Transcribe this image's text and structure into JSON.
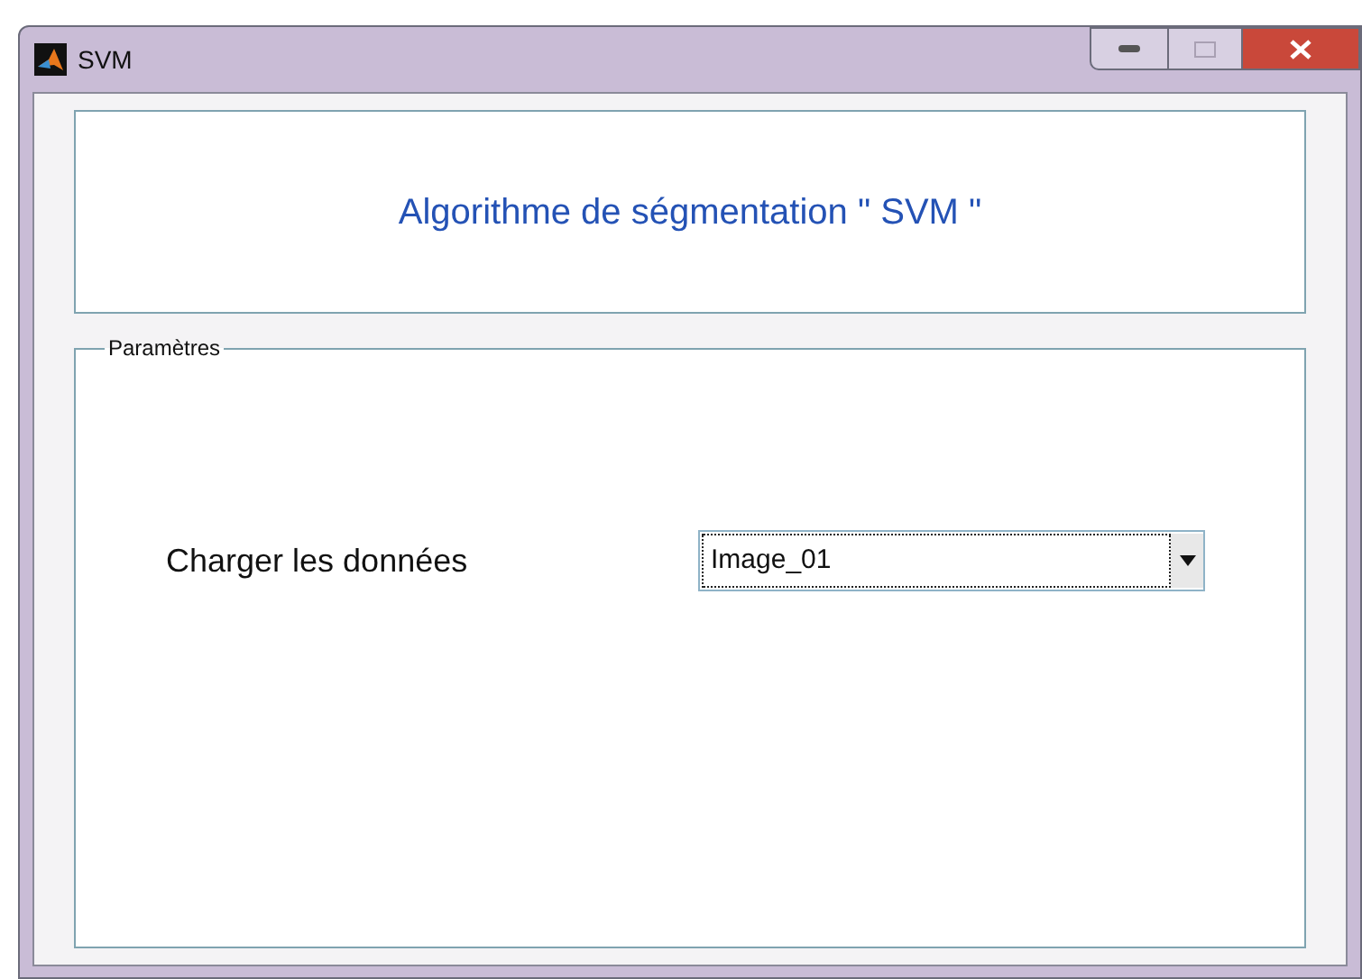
{
  "window": {
    "title": "SVM"
  },
  "header": {
    "title": "Algorithme de ségmentation \" SVM \""
  },
  "parameters": {
    "legend": "Paramètres",
    "label": "Charger les données",
    "dropdown": {
      "value": "Image_01"
    }
  }
}
